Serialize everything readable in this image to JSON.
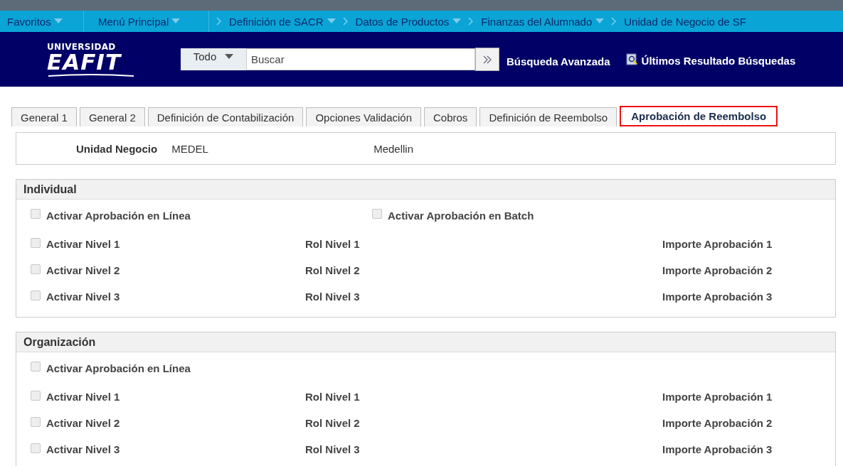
{
  "nav": {
    "favorites": "Favoritos",
    "main_menu": "Menú Principal",
    "breadcrumbs": [
      {
        "label": "Definición de SACR",
        "has_menu": true
      },
      {
        "label": "Datos de Productos",
        "has_menu": true
      },
      {
        "label": "Finanzas del Alumnado",
        "has_menu": true
      },
      {
        "label": "Unidad de Negocio de SF",
        "has_menu": false
      }
    ]
  },
  "header": {
    "logo_top": "UNIVERSIDAD",
    "logo_main": "EAFIT",
    "search_scope": "Todo",
    "search": {
      "placeholder": "Buscar"
    },
    "advanced_search": "Búsqueda Avanzada",
    "recent_results": "Últimos Resultado Búsquedas"
  },
  "tabs": [
    {
      "label": "General 1",
      "selected": false
    },
    {
      "label": "General 2",
      "selected": false
    },
    {
      "label": "Definición de Contabilización",
      "selected": false
    },
    {
      "label": "Opciones Validación",
      "selected": false
    },
    {
      "label": "Cobros",
      "selected": false
    },
    {
      "label": "Definición de Reembolso",
      "selected": false
    },
    {
      "label": "Aprobación de Reembolso",
      "selected": true
    }
  ],
  "business_unit": {
    "label": "Unidad Negocio",
    "code": "MEDEL",
    "description": "Medellin"
  },
  "sections": [
    {
      "title": "Individual",
      "top_options": [
        {
          "label": "Activar Aprobación en Línea",
          "checked": false,
          "disabled": true
        },
        {
          "label": "Activar Aprobación en Batch",
          "checked": false,
          "disabled": true
        }
      ],
      "levels": [
        {
          "label": "Activar Nivel 1",
          "checked": false,
          "disabled": true,
          "role": "Rol Nivel 1",
          "amount": "Importe Aprobación 1"
        },
        {
          "label": "Activar Nivel 2",
          "checked": false,
          "disabled": true,
          "role": "Rol Nivel 2",
          "amount": "Importe Aprobación 2"
        },
        {
          "label": "Activar Nivel 3",
          "checked": false,
          "disabled": true,
          "role": "Rol Nivel 3",
          "amount": "Importe Aprobación 3"
        }
      ]
    },
    {
      "title": "Organización",
      "top_options": [
        {
          "label": "Activar Aprobación en Línea",
          "checked": false,
          "disabled": true
        }
      ],
      "levels": [
        {
          "label": "Activar Nivel 1",
          "checked": false,
          "disabled": true,
          "role": "Rol Nivel 1",
          "amount": "Importe Aprobación 1"
        },
        {
          "label": "Activar Nivel 2",
          "checked": false,
          "disabled": true,
          "role": "Rol Nivel 2",
          "amount": "Importe Aprobación 2"
        },
        {
          "label": "Activar Nivel 3",
          "checked": false,
          "disabled": true,
          "role": "Rol Nivel 3",
          "amount": "Importe Aprobación 3"
        }
      ]
    }
  ]
}
